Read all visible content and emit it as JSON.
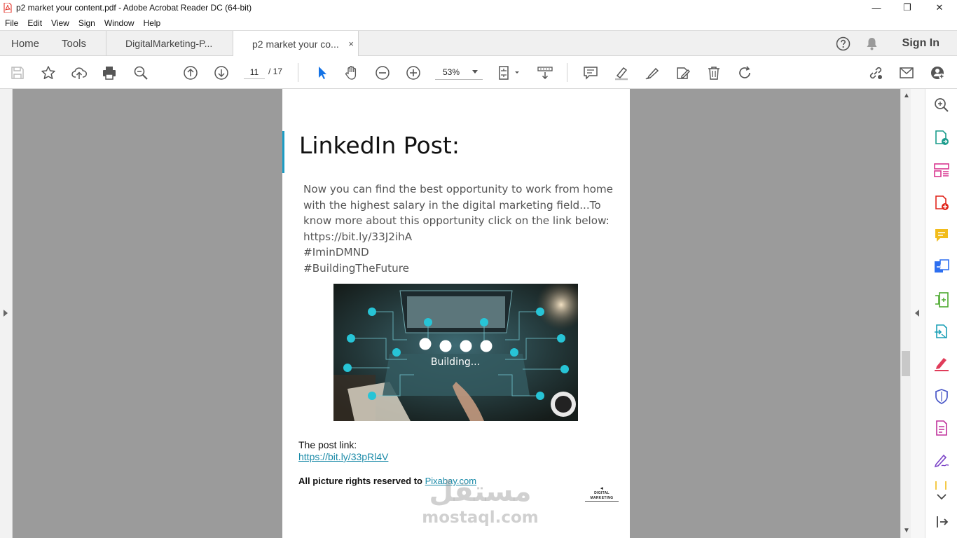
{
  "window": {
    "title": "p2 market your content.pdf - Adobe Acrobat Reader DC (64-bit)",
    "minimize": "—",
    "maximize": "❐",
    "close": "✕"
  },
  "menu": [
    "File",
    "Edit",
    "View",
    "Sign",
    "Window",
    "Help"
  ],
  "tabs": {
    "home": "Home",
    "tools": "Tools",
    "doc1": "DigitalMarketing-P...",
    "doc2": "p2 market your co...",
    "close": "×"
  },
  "header": {
    "signin": "Sign In"
  },
  "toolbar": {
    "page_current": "11",
    "page_total": "/ 17",
    "zoom": "53%"
  },
  "document": {
    "heading": "LinkedIn Post:",
    "body_lines": [
      "Now you can find the best opportunity to work from home",
      "with the highest salary in the digital marketing field...To",
      "know more about this opportunity click on the link below:",
      "https://bit.ly/33J2ihA",
      "#IminDMND",
      "#BuildingTheFuture"
    ],
    "image_caption": "Building...",
    "post_link_label": "The post link:",
    "post_link": "https://bit.ly/33pRl4V",
    "rights_text": "All picture rights reserved to ",
    "rights_link": "Pixabay.com",
    "logo_text": "DIGITAL MARKETING",
    "watermark_ar": "مستقل",
    "watermark_en": "mostaql.com"
  },
  "colors": {
    "accent": "#1c9cc4",
    "link": "#1a8aa8",
    "viewer_bg": "#9b9b9b",
    "acrobat_red": "#e1251b"
  },
  "right_tools": [
    "enhance-scan-icon",
    "export-pdf-icon",
    "organize-pages-icon",
    "create-pdf-icon",
    "comment-icon",
    "combine-files-icon",
    "compress-icon",
    "export-convert-icon",
    "fill-sign-icon",
    "protect-icon",
    "scan-ocr-icon",
    "request-signature-icon"
  ]
}
